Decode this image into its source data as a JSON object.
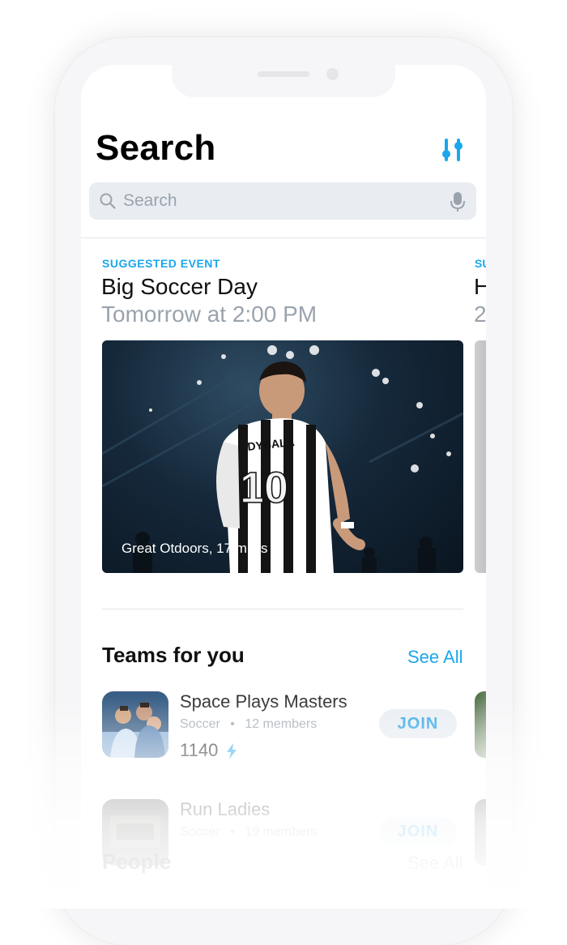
{
  "header": {
    "title": "Search",
    "filter_icon": "sliders-icon"
  },
  "search": {
    "placeholder": "Search",
    "search_icon": "magnifier-icon",
    "mic_icon": "microphone-icon"
  },
  "suggested_event": {
    "tag": "SUGGESTED EVENT",
    "name": "Big Soccer Day",
    "time": "Tomorrow at 2:00 PM",
    "location": "Great Otdoors, 17 miles"
  },
  "peek_event": {
    "tag": "SU",
    "name": "H",
    "time": "2"
  },
  "teams": {
    "title": "Teams for you",
    "see_all": "See All",
    "items": [
      {
        "name": "Space Plays Masters",
        "sport": "Soccer",
        "members": "12 members",
        "score": "1140",
        "join_label": "JOIN"
      },
      {
        "name": "Run Ladies",
        "sport": "Soccer",
        "members": "19 members",
        "score": "",
        "join_label": "JOIN"
      }
    ]
  },
  "people": {
    "title": "People",
    "see_all": "See All"
  },
  "colors": {
    "accent": "#1aa7ec",
    "secondary_text": "#9aa3ad",
    "search_bg": "#e9edf2"
  }
}
